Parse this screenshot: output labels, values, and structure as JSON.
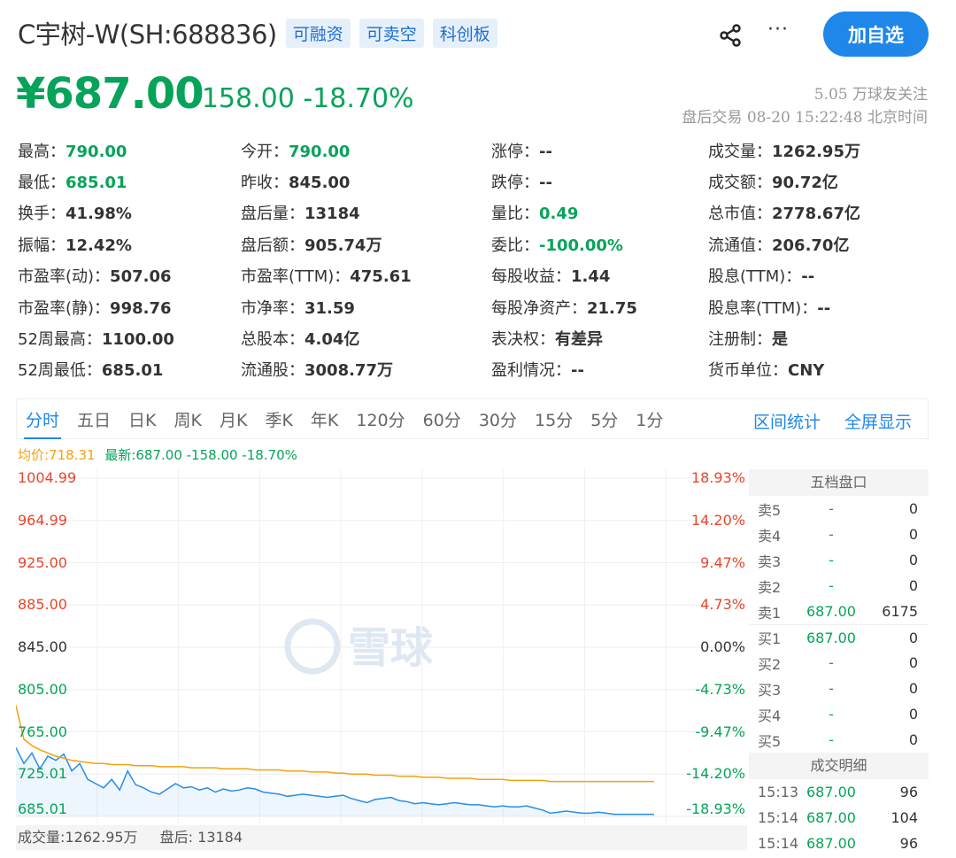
{
  "header": {
    "stock_name": "C宇树-W(SH:688836)",
    "tags": [
      "可融资",
      "可卖空",
      "科创板"
    ],
    "more_label": "···",
    "follow_label": "加自选"
  },
  "price": {
    "current": "¥687.00",
    "change": "-158.00 -18.70%",
    "followers": "5.05 万球友关注",
    "trade_time": "盘后交易 08-20 15:22:48 北京时间"
  },
  "stats": [
    [
      {
        "k": "最高：",
        "v": "790.00",
        "green": true
      },
      {
        "k": "今开：",
        "v": "790.00",
        "green": true
      },
      {
        "k": "涨停：",
        "v": "--"
      },
      {
        "k": "成交量：",
        "v": "1262.95万"
      }
    ],
    [
      {
        "k": "最低：",
        "v": "685.01",
        "green": true
      },
      {
        "k": "昨收：",
        "v": "845.00"
      },
      {
        "k": "跌停：",
        "v": "--"
      },
      {
        "k": "成交额：",
        "v": "90.72亿"
      }
    ],
    [
      {
        "k": "换手：",
        "v": "41.98%"
      },
      {
        "k": "盘后量：",
        "v": "13184"
      },
      {
        "k": "量比：",
        "v": "0.49",
        "green": true
      },
      {
        "k": "总市值：",
        "v": "2778.67亿"
      }
    ],
    [
      {
        "k": "振幅：",
        "v": "12.42%"
      },
      {
        "k": "盘后额：",
        "v": "905.74万"
      },
      {
        "k": "委比：",
        "v": "-100.00%",
        "green": true
      },
      {
        "k": "流通值：",
        "v": "206.70亿"
      }
    ],
    [
      {
        "k": "市盈率(动)：",
        "v": "507.06"
      },
      {
        "k": "市盈率(TTM)：",
        "v": "475.61"
      },
      {
        "k": "每股收益：",
        "v": "1.44"
      },
      {
        "k": "股息(TTM)：",
        "v": "--"
      }
    ],
    [
      {
        "k": "市盈率(静)：",
        "v": "998.76"
      },
      {
        "k": "市净率：",
        "v": "31.59"
      },
      {
        "k": "每股净资产：",
        "v": "21.75"
      },
      {
        "k": "股息率(TTM)：",
        "v": "--"
      }
    ],
    [
      {
        "k": "52周最高：",
        "v": "1100.00"
      },
      {
        "k": "总股本：",
        "v": "4.04亿"
      },
      {
        "k": "表决权：",
        "v": "有差异"
      },
      {
        "k": "注册制：",
        "v": "是"
      }
    ],
    [
      {
        "k": "52周最低：",
        "v": "685.01"
      },
      {
        "k": "流通股：",
        "v": "3008.77万"
      },
      {
        "k": "盈利情况：",
        "v": "--"
      },
      {
        "k": "货币单位：",
        "v": "CNY"
      }
    ]
  ],
  "tabs": [
    "分时",
    "五日",
    "日K",
    "周K",
    "月K",
    "季K",
    "年K",
    "120分",
    "60分",
    "30分",
    "15分",
    "5分",
    "1分"
  ],
  "tab_right": [
    "区间统计",
    "全屏显示"
  ],
  "legend": {
    "avg": "均价:718.31",
    "latest": "最新:687.00 -158.00 -18.70%"
  },
  "watermark": "雪球",
  "chart_data": {
    "type": "line",
    "y_labels": [
      "1004.99",
      "964.99",
      "925.00",
      "885.00",
      "845.00",
      "805.00",
      "765.00",
      "725.01",
      "685.01"
    ],
    "y_pct_labels": [
      "18.93%",
      "14.20%",
      "9.47%",
      "4.73%",
      "0.00%",
      "-4.73%",
      "-9.47%",
      "-14.20%",
      "-18.93%"
    ],
    "ylim": [
      685.01,
      1004.99
    ],
    "prev_close": 845.0,
    "series": [
      {
        "name": "最新",
        "color": "#2a8ce8",
        "values": [
          750,
          735,
          745,
          730,
          742,
          738,
          744,
          728,
          735,
          720,
          716,
          712,
          720,
          710,
          728,
          715,
          712,
          708,
          706,
          711,
          716,
          712,
          713,
          710,
          712,
          708,
          711,
          709,
          710,
          712,
          711,
          708,
          707,
          706,
          704,
          705,
          706,
          705,
          704,
          703,
          704,
          705,
          702,
          700,
          698,
          701,
          702,
          703,
          700,
          699,
          697,
          698,
          697,
          696,
          697,
          698,
          697,
          696,
          696,
          695,
          694,
          695,
          694,
          694,
          695,
          693,
          691,
          688,
          689,
          690,
          689,
          688,
          688,
          689,
          688,
          687,
          687,
          687,
          687,
          687,
          687
        ]
      },
      {
        "name": "均价",
        "color": "#f3a20d",
        "values": [
          790,
          758,
          752,
          748,
          745,
          742,
          740,
          738,
          737,
          736,
          735,
          735,
          734,
          734,
          734,
          733,
          733,
          733,
          732,
          732,
          732,
          732,
          731,
          731,
          731,
          731,
          730,
          730,
          730,
          730,
          729,
          729,
          729,
          729,
          728,
          728,
          728,
          727,
          727,
          727,
          726,
          726,
          725,
          725,
          725,
          724,
          724,
          724,
          723,
          723,
          723,
          722,
          722,
          722,
          721,
          721,
          721,
          721,
          720,
          720,
          720,
          720,
          719,
          719,
          719,
          719,
          719,
          718,
          718,
          718,
          718,
          718,
          718,
          718,
          718,
          718,
          718,
          718,
          718,
          718,
          718
        ]
      }
    ],
    "volume_label": "成交量:1262.95万",
    "after_hours_label": "盘后: 13184"
  },
  "order_book": {
    "title": "五档盘口",
    "asks": [
      {
        "k": "卖5",
        "p": "-",
        "q": "0"
      },
      {
        "k": "卖4",
        "p": "-",
        "q": "0"
      },
      {
        "k": "卖3",
        "p": "-",
        "q": "0"
      },
      {
        "k": "卖2",
        "p": "-",
        "q": "0"
      },
      {
        "k": "卖1",
        "p": "687.00",
        "q": "6175"
      }
    ],
    "bids": [
      {
        "k": "买1",
        "p": "687.00",
        "q": "0"
      },
      {
        "k": "买2",
        "p": "-",
        "q": "0"
      },
      {
        "k": "买3",
        "p": "-",
        "q": "0"
      },
      {
        "k": "买4",
        "p": "-",
        "q": "0"
      },
      {
        "k": "买5",
        "p": "-",
        "q": "0"
      }
    ],
    "trades_title": "成交明细",
    "trades": [
      {
        "k": "15:13",
        "p": "687.00",
        "q": "96"
      },
      {
        "k": "15:14",
        "p": "687.00",
        "q": "104"
      },
      {
        "k": "15:14",
        "p": "687.00",
        "q": "96"
      }
    ]
  }
}
